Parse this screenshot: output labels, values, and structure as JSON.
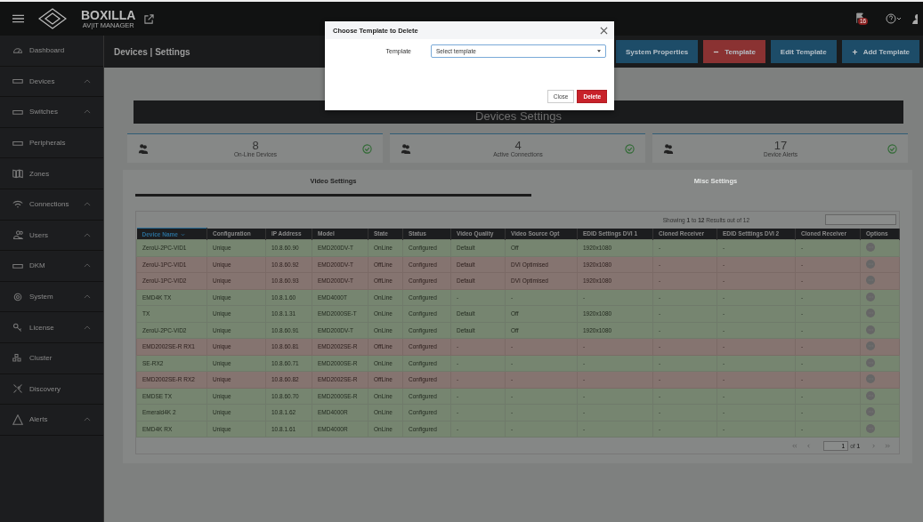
{
  "topbar": {
    "brand": "BOXILLA",
    "tagline": "AV|IT MANAGER",
    "notification_count": "16"
  },
  "sidebar": {
    "items": [
      {
        "label": "Dashboard",
        "expandable": false
      },
      {
        "label": "Devices",
        "expandable": true
      },
      {
        "label": "Switches",
        "expandable": true
      },
      {
        "label": "Peripherals",
        "expandable": false
      },
      {
        "label": "Zones",
        "expandable": false
      },
      {
        "label": "Connections",
        "expandable": true
      },
      {
        "label": "Users",
        "expandable": true
      },
      {
        "label": "DKM",
        "expandable": true
      },
      {
        "label": "System",
        "expandable": true
      },
      {
        "label": "License",
        "expandable": true
      },
      {
        "label": "Cluster",
        "expandable": false
      },
      {
        "label": "Discovery",
        "expandable": false
      },
      {
        "label": "Alerts",
        "expandable": true
      }
    ]
  },
  "header": {
    "title": "Devices | Settings",
    "buttons": [
      {
        "label": "System Properties",
        "kind": "primary"
      },
      {
        "label": "Template",
        "kind": "danger"
      },
      {
        "label": "Edit Template",
        "kind": "primary"
      },
      {
        "label": "Add Template",
        "kind": "primary"
      }
    ]
  },
  "banner": "Devices Settings",
  "stats": [
    {
      "value": "8",
      "label": "On-Line Devices"
    },
    {
      "value": "4",
      "label": "Active Connections"
    },
    {
      "value": "17",
      "label": "Device Alerts"
    }
  ],
  "tabs": [
    {
      "label": "Video Settings",
      "selected": true
    },
    {
      "label": "Misc Settings",
      "selected": false
    }
  ],
  "table": {
    "summary": "Showing **1** to **12** Results out of 12",
    "columns": [
      {
        "label": "Device Name",
        "sorted": true
      },
      {
        "label": "Configuration",
        "sorted": false
      },
      {
        "label": "IP Address",
        "sorted": false
      },
      {
        "label": "Model",
        "sorted": false
      },
      {
        "label": "State",
        "sorted": false
      },
      {
        "label": "Status",
        "sorted": false
      },
      {
        "label": "Video Quality",
        "sorted": false
      },
      {
        "label": "Video Source Opt",
        "sorted": false
      },
      {
        "label": "EDID Settings DVI 1",
        "sorted": false
      },
      {
        "label": "Cloned Receiver",
        "sorted": false
      },
      {
        "label": "EDID Setttings DVI 2",
        "sorted": false
      },
      {
        "label": "Cloned Receiver",
        "sorted": false
      },
      {
        "label": "Options",
        "sorted": false
      }
    ],
    "rows": [
      {
        "online": true,
        "cells": [
          "ZeroU-2PC-VID1",
          "Unique",
          "10.8.60.90",
          "EMD200DV-T",
          "OnLine",
          "Configured",
          "Default",
          "Off",
          "1920x1080",
          "-",
          "-",
          "-"
        ]
      },
      {
        "online": false,
        "cells": [
          "ZeroU-1PC-VID1",
          "Unique",
          "10.8.60.92",
          "EMD200DV-T",
          "OffLine",
          "Configured",
          "Default",
          "DVI Optimised",
          "1920x1080",
          "-",
          "-",
          "-"
        ]
      },
      {
        "online": false,
        "cells": [
          "ZeroU-1PC-VID2",
          "Unique",
          "10.8.60.93",
          "EMD200DV-T",
          "OffLine",
          "Configured",
          "Default",
          "DVI Optimised",
          "1920x1080",
          "-",
          "-",
          "-"
        ]
      },
      {
        "online": true,
        "cells": [
          "EMD4K TX",
          "Unique",
          "10.8.1.60",
          "EMD4000T",
          "OnLine",
          "Configured",
          "-",
          "-",
          "-",
          "-",
          "-",
          "-"
        ]
      },
      {
        "online": true,
        "cells": [
          "TX",
          "Unique",
          "10.8.1.31",
          "EMD2000SE-T",
          "OnLine",
          "Configured",
          "Default",
          "Off",
          "1920x1080",
          "-",
          "-",
          "-"
        ]
      },
      {
        "online": true,
        "cells": [
          "ZeroU-2PC-VID2",
          "Unique",
          "10.8.60.91",
          "EMD200DV-T",
          "OnLine",
          "Configured",
          "Default",
          "Off",
          "1920x1080",
          "-",
          "-",
          "-"
        ]
      },
      {
        "online": false,
        "cells": [
          "EMD2002SE-R RX1",
          "Unique",
          "10.8.60.81",
          "EMD2002SE-R",
          "OffLine",
          "Configured",
          "-",
          "-",
          "-",
          "-",
          "-",
          "-"
        ]
      },
      {
        "online": true,
        "cells": [
          "SE-RX2",
          "Unique",
          "10.8.60.71",
          "EMD2000SE-R",
          "OnLine",
          "Configured",
          "-",
          "-",
          "-",
          "-",
          "-",
          "-"
        ]
      },
      {
        "online": false,
        "cells": [
          "EMD2002SE-R RX2",
          "Unique",
          "10.8.60.82",
          "EMD2002SE-R",
          "OffLine",
          "Configured",
          "-",
          "-",
          "-",
          "-",
          "-",
          "-"
        ]
      },
      {
        "online": true,
        "cells": [
          "EMDSE TX",
          "Unique",
          "10.8.60.70",
          "EMD2000SE-R",
          "OnLine",
          "Configured",
          "-",
          "-",
          "-",
          "-",
          "-",
          "-"
        ]
      },
      {
        "online": true,
        "cells": [
          "Emerald4K 2",
          "Unique",
          "10.8.1.62",
          "EMD4000R",
          "OnLine",
          "Configured",
          "-",
          "-",
          "-",
          "-",
          "-",
          "-"
        ]
      },
      {
        "online": true,
        "cells": [
          "EMD4K RX",
          "Unique",
          "10.8.1.61",
          "EMD4000R",
          "OnLine",
          "Configured",
          "-",
          "-",
          "-",
          "-",
          "-",
          "-"
        ]
      }
    ]
  },
  "pagination": {
    "page": "1",
    "total": "of **1**"
  },
  "modal": {
    "title": "Choose Template to Delete",
    "field_label": "Template",
    "placeholder": "Select template",
    "buttons": [
      {
        "label": "Close",
        "kind": "default"
      },
      {
        "label": "Delete",
        "kind": "danger"
      }
    ]
  }
}
